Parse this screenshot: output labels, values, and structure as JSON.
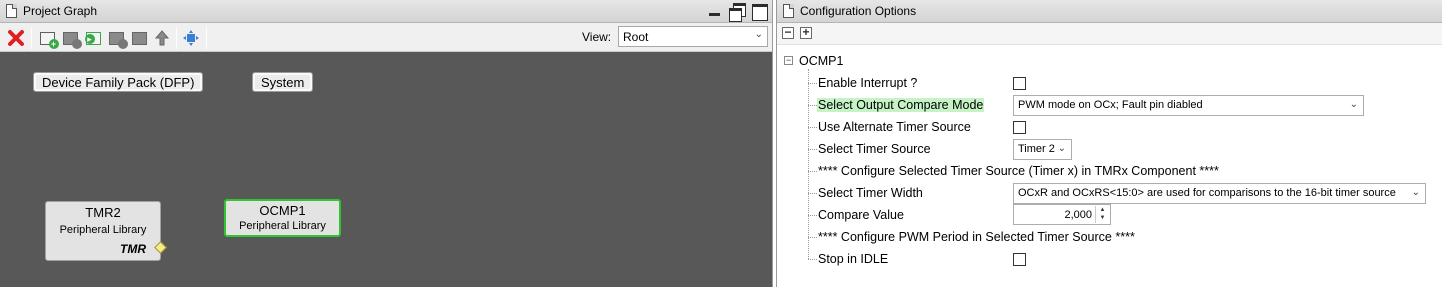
{
  "left_panel": {
    "title": "Project Graph",
    "view_label": "View:",
    "view_value": "Root",
    "toolbar_icons": [
      "delete-icon",
      "new-component-icon",
      "component-icon",
      "add-component-icon",
      "component-icon",
      "component-icon",
      "move-up-icon",
      "fit-view-icon"
    ],
    "canvas": {
      "groups": [
        {
          "label": "Device Family Pack (DFP)"
        },
        {
          "label": "System"
        }
      ],
      "nodes": [
        {
          "title": "TMR2",
          "subtitle": "Peripheral Library",
          "capability": "TMR"
        },
        {
          "title": "OCMP1",
          "subtitle": "Peripheral Library"
        }
      ]
    }
  },
  "right_panel": {
    "title": "Configuration Options",
    "root": "OCMP1",
    "rows": [
      {
        "label": "Enable Interrupt ?",
        "control": "checkbox",
        "checked": false
      },
      {
        "label": "Select Output Compare Mode",
        "control": "dropdown",
        "value": "PWM mode on OCx; Fault pin diabled",
        "highlighted": true
      },
      {
        "label": "Use Alternate Timer Source",
        "control": "checkbox",
        "checked": false
      },
      {
        "label": "Select Timer Source",
        "control": "dropdown",
        "value": "Timer 2"
      },
      {
        "label": "**** Configure Selected Timer Source (Timer x) in TMRx Component ****",
        "control": "none"
      },
      {
        "label": "Select Timer Width",
        "control": "dropdown",
        "value": "OCxR and OCxRS<15:0> are used for comparisons to the 16-bit timer source"
      },
      {
        "label": "Compare Value",
        "control": "spinner",
        "value": "2,000"
      },
      {
        "label": "**** Configure PWM Period in Selected Timer Source ****",
        "control": "none"
      },
      {
        "label": "Stop in IDLE",
        "control": "checkbox",
        "checked": false
      }
    ]
  },
  "colors": {
    "canvas_bg": "#585858",
    "selected_node_border": "#31c42f",
    "highlight_label_bg": "#c6f3c6",
    "delete_icon": "#e02020"
  }
}
